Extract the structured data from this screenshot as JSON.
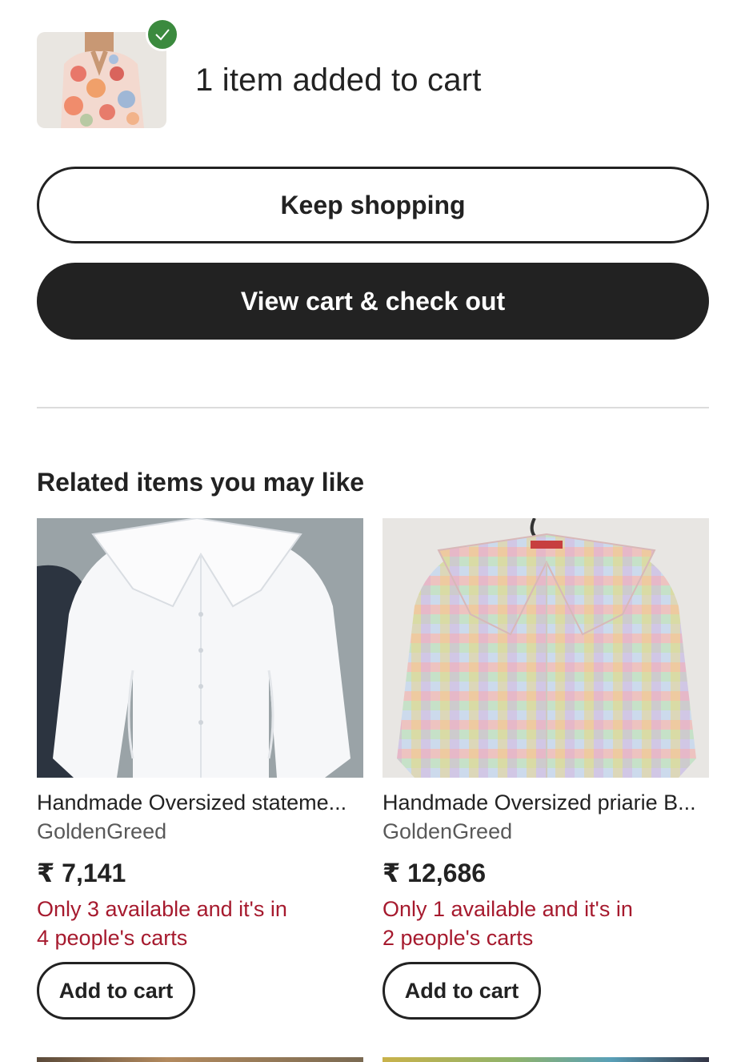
{
  "confirmation": {
    "title": "1 item added to cart",
    "thumbnail_alt": "Floral oversized shirt"
  },
  "buttons": {
    "keep_shopping": "Keep shopping",
    "view_cart": "View cart & check out"
  },
  "related": {
    "heading": "Related items you may like",
    "items": [
      {
        "title": "Handmade Oversized stateme...",
        "shop": "GoldenGreed",
        "price": "₹ 7,141",
        "stock_line1": "Only 3 available and it's in",
        "stock_line2": "4 people's carts",
        "add_label": "Add to cart"
      },
      {
        "title": "Handmade Oversized priarie B...",
        "shop": "GoldenGreed",
        "price": "₹ 12,686",
        "stock_line1": "Only 1 available and it's in",
        "stock_line2": "2 people's carts",
        "add_label": "Add to cart"
      }
    ]
  },
  "colors": {
    "primary": "#222222",
    "success": "#3b8a3e",
    "urgency": "#a61a2e",
    "muted": "#595959"
  }
}
